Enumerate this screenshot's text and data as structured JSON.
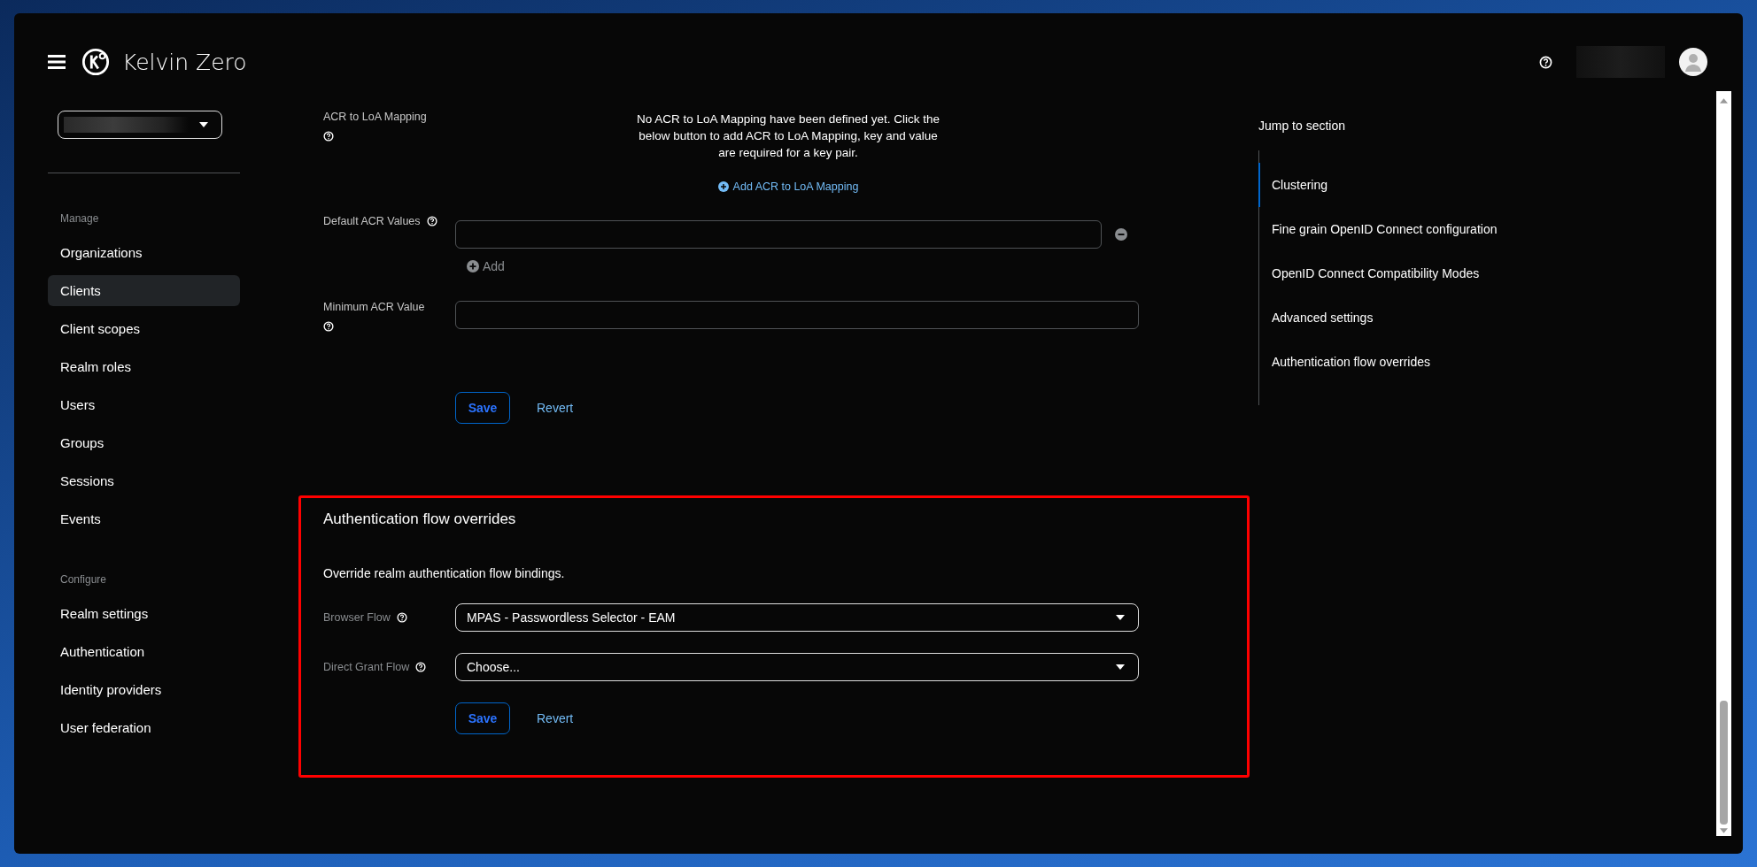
{
  "header": {
    "brand": "Kelvin Zero"
  },
  "sidebar": {
    "sections": [
      {
        "heading": "Manage",
        "items": [
          {
            "label": "Organizations",
            "selected": false
          },
          {
            "label": "Clients",
            "selected": true
          },
          {
            "label": "Client scopes",
            "selected": false
          },
          {
            "label": "Realm roles",
            "selected": false
          },
          {
            "label": "Users",
            "selected": false
          },
          {
            "label": "Groups",
            "selected": false
          },
          {
            "label": "Sessions",
            "selected": false
          },
          {
            "label": "Events",
            "selected": false
          }
        ]
      },
      {
        "heading": "Configure",
        "items": [
          {
            "label": "Realm settings",
            "selected": false
          },
          {
            "label": "Authentication",
            "selected": false
          },
          {
            "label": "Identity providers",
            "selected": false
          },
          {
            "label": "User federation",
            "selected": false
          }
        ]
      }
    ]
  },
  "acr_section": {
    "mapping_label": "ACR to LoA Mapping",
    "empty_text": "No ACR to LoA Mapping have been defined yet. Click the below button to add ACR to LoA Mapping, key and value are required for a key pair.",
    "add_mapping": "Add ACR to LoA Mapping",
    "default_acr_label": "Default ACR Values",
    "add_value": "Add",
    "minimum_acr_label": "Minimum ACR Value",
    "save": "Save",
    "revert": "Revert"
  },
  "auth_flow": {
    "title": "Authentication flow overrides",
    "description": "Override realm authentication flow bindings.",
    "fields": [
      {
        "label": "Browser Flow",
        "value": "MPAS - Passwordless Selector - EAM"
      },
      {
        "label": "Direct Grant Flow",
        "placeholder": "Choose..."
      }
    ],
    "save": "Save",
    "revert": "Revert"
  },
  "jump": {
    "title": "Jump to section",
    "items": [
      {
        "label": "Clustering",
        "selected": true
      },
      {
        "label": "Fine grain OpenID Connect configuration",
        "selected": false
      },
      {
        "label": "OpenID Connect Compatibility Modes",
        "selected": false
      },
      {
        "label": "Advanced settings",
        "selected": false
      },
      {
        "label": "Authentication flow overrides",
        "selected": false
      }
    ]
  }
}
